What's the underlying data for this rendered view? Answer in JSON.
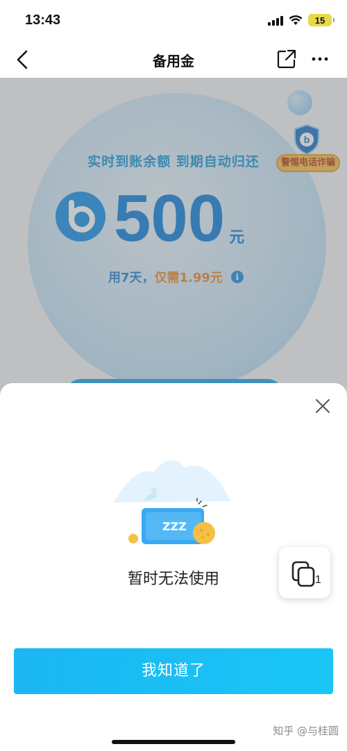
{
  "status_bar": {
    "time": "13:43",
    "battery": "15",
    "icons": [
      "signal-icon",
      "wifi-icon",
      "battery-icon"
    ]
  },
  "nav": {
    "title": "备用金",
    "icons": [
      "back-chevron-icon",
      "share-icon",
      "more-icon"
    ]
  },
  "main": {
    "slogan": "实时到账余额 到期自动归还",
    "amount": "500",
    "amount_unit": "元",
    "fee_part1": "用7天，",
    "fee_part2": "仅需1.99元",
    "info_glyph": "i",
    "fraud_badge": "警惕电话诈骗",
    "brand_color": "#0b7fde"
  },
  "sheet": {
    "zzz_text": "ZZZ",
    "message": "暂时无法使用",
    "button_label": "我知道了",
    "float_button_count": "1",
    "accent_color": "#1bb6f3"
  },
  "watermark": "知乎 @与桂圆"
}
